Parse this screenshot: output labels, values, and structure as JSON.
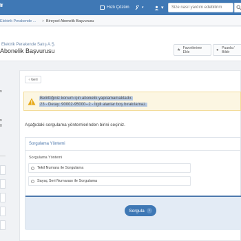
{
  "topbar": {
    "logo_fragment": "s",
    "logo_sup": "tr",
    "quick_solution": "Hızlı Çözüm",
    "search_placeholder": "Size nasıl yardım edebilirim"
  },
  "breadcrumb": {
    "item1": "Elektrik Perakende ...",
    "separator": ">",
    "item2": "Bireysel Abonelik Başvurusu"
  },
  "subheader": {
    "company": "Elektrik Perakende Satış A.Ş.",
    "title": "Abonelik Başvurusu",
    "favorite_label": "Favorilerime Ekle",
    "feedback_label": "Puanla / Bildir"
  },
  "leftcol": {
    "t1": "n",
    "t2": "n",
    "t3": "0"
  },
  "back_button": "Geri",
  "alert": {
    "line1": "Belirttiğiniz konum için abonelik yapılamamaktadır.",
    "line2": "23 - Detay: 90002-95000--2 - İlgili alanlar boş bırakılamaz."
  },
  "instruction": "Aşağıdaki sorgulama yöntemlerinden birini seçiniz.",
  "panel": {
    "title": "Sorgulama Yöntemi",
    "method_label": "Sorgulama Yöntemi",
    "options": [
      "Tekil Numara ile Sorgulama",
      "Sayaç Seri Numarası ile Sorgulama"
    ],
    "submit_label": "Sorgula"
  },
  "colors": {
    "primary": "#3f78b5",
    "alert_bg": "#fcf6e2",
    "warning": "#e6a817"
  }
}
